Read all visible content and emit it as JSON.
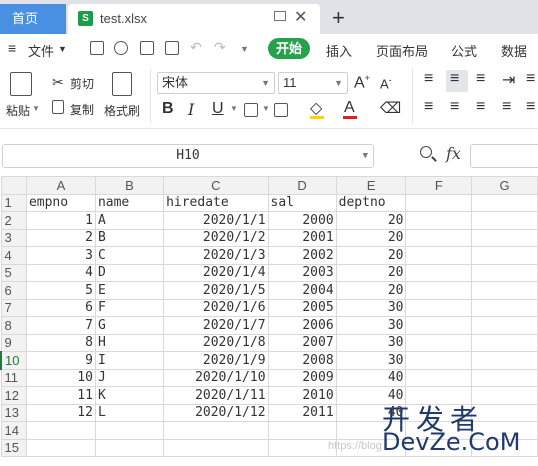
{
  "tabs": {
    "home": "首页",
    "file_name": "test.xlsx",
    "doc_icon": "S",
    "add": "+"
  },
  "menu": {
    "file": "文件",
    "start": "开始",
    "insert": "插入",
    "page_layout": "页面布局",
    "formula": "公式",
    "data": "数据"
  },
  "ribbon": {
    "paste": "粘贴",
    "cut": "剪切",
    "copy": "复制",
    "format_painter": "格式刷",
    "font_name": "宋体",
    "font_size": "11",
    "bold": "B",
    "italic": "I",
    "underline": "U",
    "grow": "A⁺",
    "shrink": "A⁻",
    "font_color": "A"
  },
  "formula_bar": {
    "cell_ref": "H10",
    "fx": "fx"
  },
  "sheet": {
    "columns": [
      "A",
      "B",
      "C",
      "D",
      "E",
      "F",
      "G"
    ],
    "rows": [
      {
        "n": "1",
        "A": "empno",
        "B": "name",
        "C": "hiredate",
        "D": "sal",
        "E": "deptno"
      },
      {
        "n": "2",
        "A": "1",
        "B": "A",
        "C": "2020/1/1",
        "D": "2000",
        "E": "20"
      },
      {
        "n": "3",
        "A": "2",
        "B": "B",
        "C": "2020/1/2",
        "D": "2001",
        "E": "20"
      },
      {
        "n": "4",
        "A": "3",
        "B": "C",
        "C": "2020/1/3",
        "D": "2002",
        "E": "20"
      },
      {
        "n": "5",
        "A": "4",
        "B": "D",
        "C": "2020/1/4",
        "D": "2003",
        "E": "20"
      },
      {
        "n": "6",
        "A": "5",
        "B": "E",
        "C": "2020/1/5",
        "D": "2004",
        "E": "20"
      },
      {
        "n": "7",
        "A": "6",
        "B": "F",
        "C": "2020/1/6",
        "D": "2005",
        "E": "30"
      },
      {
        "n": "8",
        "A": "7",
        "B": "G",
        "C": "2020/1/7",
        "D": "2006",
        "E": "30"
      },
      {
        "n": "9",
        "A": "8",
        "B": "H",
        "C": "2020/1/8",
        "D": "2007",
        "E": "30"
      },
      {
        "n": "10",
        "A": "9",
        "B": "I",
        "C": "2020/1/9",
        "D": "2008",
        "E": "30"
      },
      {
        "n": "11",
        "A": "10",
        "B": "J",
        "C": "2020/1/10",
        "D": "2009",
        "E": "40"
      },
      {
        "n": "12",
        "A": "11",
        "B": "K",
        "C": "2020/1/11",
        "D": "2010",
        "E": "40"
      },
      {
        "n": "13",
        "A": "12",
        "B": "L",
        "C": "2020/1/12",
        "D": "2011",
        "E": "40"
      },
      {
        "n": "14",
        "A": "",
        "B": "",
        "C": "",
        "D": "",
        "E": ""
      },
      {
        "n": "15",
        "A": "",
        "B": "",
        "C": "",
        "D": "",
        "E": ""
      }
    ],
    "active_row": "10"
  },
  "watermark": {
    "cn": "开发者",
    "en": "DevZe.CoM",
    "faint": "https://blog"
  },
  "colors": {
    "home_tab": "#4a90e2",
    "start_pill": "#27a14c",
    "active_header": "#1e7b3b"
  }
}
